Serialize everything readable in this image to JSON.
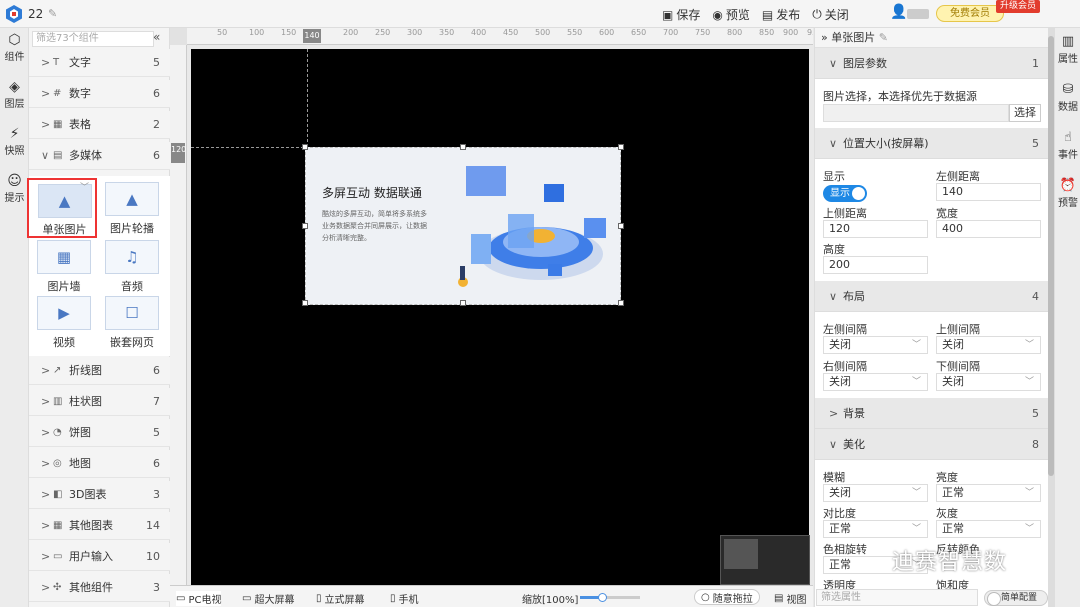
{
  "app": {
    "project_number": "22",
    "accent": "#1e88e5"
  },
  "topbar": {
    "actions": [
      {
        "icon": "save-icon",
        "label": "保存"
      },
      {
        "icon": "eye-icon",
        "label": "预览"
      },
      {
        "icon": "publish-icon",
        "label": "发布"
      },
      {
        "icon": "power-icon",
        "label": "关闭"
      }
    ],
    "vip_label": "免费会员",
    "upgrade_label": "升级会员"
  },
  "left_rail": [
    {
      "icon": "cube-icon",
      "label": "组件"
    },
    {
      "icon": "layers-icon",
      "label": "图层"
    },
    {
      "icon": "lightning-icon",
      "label": "快照"
    },
    {
      "icon": "bulb-icon",
      "label": "提示"
    }
  ],
  "components": {
    "search_placeholder": "筛选73个组件",
    "categories": [
      {
        "label": "文字",
        "count": "5",
        "expanded": false
      },
      {
        "label": "数字",
        "count": "6",
        "expanded": false
      },
      {
        "label": "表格",
        "count": "2",
        "expanded": false
      },
      {
        "label": "多媒体",
        "count": "6",
        "expanded": true
      },
      {
        "label": "折线图",
        "count": "6",
        "expanded": false
      },
      {
        "label": "柱状图",
        "count": "7",
        "expanded": false
      },
      {
        "label": "饼图",
        "count": "5",
        "expanded": false
      },
      {
        "label": "地图",
        "count": "6",
        "expanded": false
      },
      {
        "label": "3D图表",
        "count": "3",
        "expanded": false
      },
      {
        "label": "其他图表",
        "count": "14",
        "expanded": false
      },
      {
        "label": "用户输入",
        "count": "10",
        "expanded": false
      },
      {
        "label": "其他组件",
        "count": "3",
        "expanded": false
      }
    ],
    "media_tiles": [
      {
        "label": "单张图片",
        "selected": true
      },
      {
        "label": "图片轮播",
        "selected": false
      },
      {
        "label": "图片墙",
        "selected": false
      },
      {
        "label": "音频",
        "selected": false
      },
      {
        "label": "视频",
        "selected": false
      },
      {
        "label": "嵌套网页",
        "selected": false
      }
    ]
  },
  "rulers": {
    "top_ticks": [
      "50",
      "100",
      "150",
      "200",
      "250",
      "300",
      "350",
      "400",
      "450",
      "500",
      "550",
      "600",
      "650",
      "700",
      "750",
      "800",
      "850",
      "900",
      "950"
    ],
    "top_marker": "140",
    "left_marker": "120"
  },
  "canvas": {
    "image_title": "多屏互动  数据联通",
    "image_desc": "酷炫的多屏互动，简单将多系统多业务数据聚合并同屏展示，让数据分析清晰完整。"
  },
  "bottombar": {
    "tabs": [
      {
        "icon": "pc-icon",
        "label": "PC电视"
      },
      {
        "icon": "widescreen-icon",
        "label": "超大屏幕"
      },
      {
        "icon": "vertical-screen-icon",
        "label": "立式屏幕"
      },
      {
        "icon": "phone-icon",
        "label": "手机"
      }
    ],
    "zoom_label": "缩放[100%]",
    "zoom_fraction": 0.37,
    "drag_label": "随意拖拉",
    "view_label": "视图"
  },
  "properties": {
    "title": "单张图片",
    "layer_section": {
      "label": "图层参数",
      "count": "1"
    },
    "image_select_label": "图片选择，本选择优先于数据源",
    "select_button": "选择",
    "position_section": {
      "label": "位置大小(按屏幕)",
      "count": "5"
    },
    "display_label": "显示",
    "display_toggle": "显示",
    "left_label": "左侧距离",
    "left_value": "140",
    "top_label": "上侧距离",
    "top_value": "120",
    "width_label": "宽度",
    "width_value": "400",
    "height_label": "高度",
    "height_value": "200",
    "layout_section": {
      "label": "布局",
      "count": "4"
    },
    "left_gap_label": "左侧间隔",
    "left_gap_value": "关闭",
    "top_gap_label": "上侧间隔",
    "top_gap_value": "关闭",
    "right_gap_label": "右侧间隔",
    "right_gap_value": "关闭",
    "bottom_gap_label": "下侧间隔",
    "bottom_gap_value": "关闭",
    "bg_section": {
      "label": "背景",
      "count": "5"
    },
    "beautify_section": {
      "label": "美化",
      "count": "8"
    },
    "blur_label": "模糊",
    "blur_value": "关闭",
    "brightness_label": "亮度",
    "brightness_value": "正常",
    "contrast_label": "对比度",
    "contrast_value": "正常",
    "gray_label": "灰度",
    "gray_value": "正常",
    "hue_label": "色相旋转",
    "hue_value": "正常",
    "invert_label": "反转颜色",
    "opacity_label": "透明度",
    "saturation_label": "饱和度",
    "filter_placeholder": "筛选属性",
    "simple_config": "简单配置"
  },
  "right_rail": [
    {
      "icon": "properties-icon",
      "label": "属性"
    },
    {
      "icon": "database-icon",
      "label": "数据"
    },
    {
      "icon": "cursor-icon",
      "label": "事件"
    },
    {
      "icon": "alarm-icon",
      "label": "预警"
    }
  ],
  "watermark": "迪赛智慧数"
}
